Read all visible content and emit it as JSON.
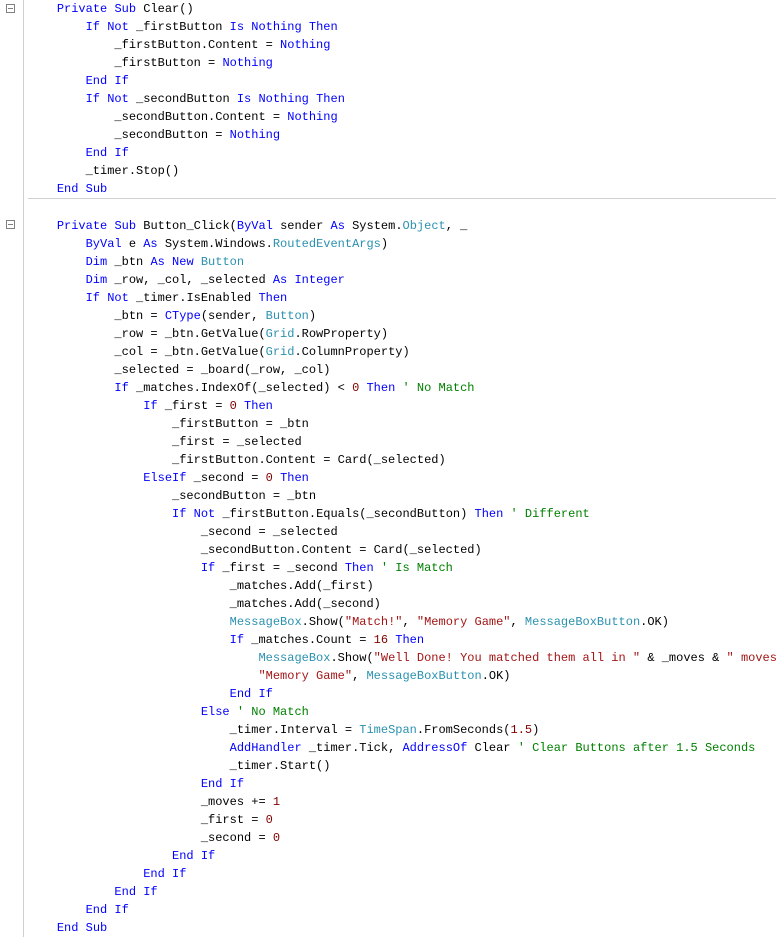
{
  "colors": {
    "keyword": "#0000ff",
    "type": "#2b91af",
    "number": "#800000",
    "string": "#a31515",
    "comment": "#008000",
    "text": "#000000"
  },
  "font": "Consolas",
  "blocks": [
    {
      "id": "clear",
      "collapse_marker_row": 0,
      "lines": [
        [
          [
            "pl",
            "    "
          ],
          [
            "kw",
            "Private"
          ],
          [
            "pl",
            " "
          ],
          [
            "kw",
            "Sub"
          ],
          [
            "pl",
            " Clear()"
          ]
        ],
        [
          [
            "pl",
            "        "
          ],
          [
            "kw",
            "If"
          ],
          [
            "pl",
            " "
          ],
          [
            "kw",
            "Not"
          ],
          [
            "pl",
            " _firstButton "
          ],
          [
            "kw",
            "Is"
          ],
          [
            "pl",
            " "
          ],
          [
            "kw",
            "Nothing"
          ],
          [
            "pl",
            " "
          ],
          [
            "kw",
            "Then"
          ]
        ],
        [
          [
            "pl",
            "            _firstButton.Content = "
          ],
          [
            "kw",
            "Nothing"
          ]
        ],
        [
          [
            "pl",
            "            _firstButton = "
          ],
          [
            "kw",
            "Nothing"
          ]
        ],
        [
          [
            "pl",
            "        "
          ],
          [
            "kw",
            "End"
          ],
          [
            "pl",
            " "
          ],
          [
            "kw",
            "If"
          ]
        ],
        [
          [
            "pl",
            "        "
          ],
          [
            "kw",
            "If"
          ],
          [
            "pl",
            " "
          ],
          [
            "kw",
            "Not"
          ],
          [
            "pl",
            " _secondButton "
          ],
          [
            "kw",
            "Is"
          ],
          [
            "pl",
            " "
          ],
          [
            "kw",
            "Nothing"
          ],
          [
            "pl",
            " "
          ],
          [
            "kw",
            "Then"
          ]
        ],
        [
          [
            "pl",
            "            _secondButton.Content = "
          ],
          [
            "kw",
            "Nothing"
          ]
        ],
        [
          [
            "pl",
            "            _secondButton = "
          ],
          [
            "kw",
            "Nothing"
          ]
        ],
        [
          [
            "pl",
            "        "
          ],
          [
            "kw",
            "End"
          ],
          [
            "pl",
            " "
          ],
          [
            "kw",
            "If"
          ]
        ],
        [
          [
            "pl",
            "        _timer.Stop()"
          ]
        ],
        [
          [
            "pl",
            "    "
          ],
          [
            "kw",
            "End"
          ],
          [
            "pl",
            " "
          ],
          [
            "kw",
            "Sub"
          ]
        ]
      ]
    },
    {
      "id": "button_click",
      "collapse_marker_row": 0,
      "lines": [
        [
          [
            "pl",
            "    "
          ],
          [
            "kw",
            "Private"
          ],
          [
            "pl",
            " "
          ],
          [
            "kw",
            "Sub"
          ],
          [
            "pl",
            " Button_Click("
          ],
          [
            "kw",
            "ByVal"
          ],
          [
            "pl",
            " sender "
          ],
          [
            "kw",
            "As"
          ],
          [
            "pl",
            " System."
          ],
          [
            "typ",
            "Object"
          ],
          [
            "pl",
            ", _"
          ]
        ],
        [
          [
            "pl",
            "        "
          ],
          [
            "kw",
            "ByVal"
          ],
          [
            "pl",
            " e "
          ],
          [
            "kw",
            "As"
          ],
          [
            "pl",
            " System.Windows."
          ],
          [
            "typ",
            "RoutedEventArgs"
          ],
          [
            "pl",
            ")"
          ]
        ],
        [
          [
            "pl",
            "        "
          ],
          [
            "kw",
            "Dim"
          ],
          [
            "pl",
            " _btn "
          ],
          [
            "kw",
            "As"
          ],
          [
            "pl",
            " "
          ],
          [
            "kw",
            "New"
          ],
          [
            "pl",
            " "
          ],
          [
            "typ",
            "Button"
          ]
        ],
        [
          [
            "pl",
            "        "
          ],
          [
            "kw",
            "Dim"
          ],
          [
            "pl",
            " _row, _col, _selected "
          ],
          [
            "kw",
            "As"
          ],
          [
            "pl",
            " "
          ],
          [
            "kw",
            "Integer"
          ]
        ],
        [
          [
            "pl",
            "        "
          ],
          [
            "kw",
            "If"
          ],
          [
            "pl",
            " "
          ],
          [
            "kw",
            "Not"
          ],
          [
            "pl",
            " _timer.IsEnabled "
          ],
          [
            "kw",
            "Then"
          ]
        ],
        [
          [
            "pl",
            "            _btn = "
          ],
          [
            "kw",
            "CType"
          ],
          [
            "pl",
            "(sender, "
          ],
          [
            "typ",
            "Button"
          ],
          [
            "pl",
            ")"
          ]
        ],
        [
          [
            "pl",
            "            _row = _btn.GetValue("
          ],
          [
            "typ",
            "Grid"
          ],
          [
            "pl",
            ".RowProperty)"
          ]
        ],
        [
          [
            "pl",
            "            _col = _btn.GetValue("
          ],
          [
            "typ",
            "Grid"
          ],
          [
            "pl",
            ".ColumnProperty)"
          ]
        ],
        [
          [
            "pl",
            "            _selected = _board(_row, _col)"
          ]
        ],
        [
          [
            "pl",
            "            "
          ],
          [
            "kw",
            "If"
          ],
          [
            "pl",
            " _matches.IndexOf(_selected) < "
          ],
          [
            "num",
            "0"
          ],
          [
            "pl",
            " "
          ],
          [
            "kw",
            "Then"
          ],
          [
            "pl",
            " "
          ],
          [
            "cmt",
            "' No Match"
          ]
        ],
        [
          [
            "pl",
            "                "
          ],
          [
            "kw",
            "If"
          ],
          [
            "pl",
            " _first = "
          ],
          [
            "num",
            "0"
          ],
          [
            "pl",
            " "
          ],
          [
            "kw",
            "Then"
          ]
        ],
        [
          [
            "pl",
            "                    _firstButton = _btn"
          ]
        ],
        [
          [
            "pl",
            "                    _first = _selected"
          ]
        ],
        [
          [
            "pl",
            "                    _firstButton.Content = Card(_selected)"
          ]
        ],
        [
          [
            "pl",
            "                "
          ],
          [
            "kw",
            "ElseIf"
          ],
          [
            "pl",
            " _second = "
          ],
          [
            "num",
            "0"
          ],
          [
            "pl",
            " "
          ],
          [
            "kw",
            "Then"
          ]
        ],
        [
          [
            "pl",
            "                    _secondButton = _btn"
          ]
        ],
        [
          [
            "pl",
            "                    "
          ],
          [
            "kw",
            "If"
          ],
          [
            "pl",
            " "
          ],
          [
            "kw",
            "Not"
          ],
          [
            "pl",
            " _firstButton.Equals(_secondButton) "
          ],
          [
            "kw",
            "Then"
          ],
          [
            "pl",
            " "
          ],
          [
            "cmt",
            "' Different"
          ]
        ],
        [
          [
            "pl",
            "                        _second = _selected"
          ]
        ],
        [
          [
            "pl",
            "                        _secondButton.Content = Card(_selected)"
          ]
        ],
        [
          [
            "pl",
            "                        "
          ],
          [
            "kw",
            "If"
          ],
          [
            "pl",
            " _first = _second "
          ],
          [
            "kw",
            "Then"
          ],
          [
            "pl",
            " "
          ],
          [
            "cmt",
            "' Is Match"
          ]
        ],
        [
          [
            "pl",
            "                            _matches.Add(_first)"
          ]
        ],
        [
          [
            "pl",
            "                            _matches.Add(_second)"
          ]
        ],
        [
          [
            "pl",
            "                            "
          ],
          [
            "typ",
            "MessageBox"
          ],
          [
            "pl",
            ".Show("
          ],
          [
            "str",
            "\"Match!\""
          ],
          [
            "pl",
            ", "
          ],
          [
            "str",
            "\"Memory Game\""
          ],
          [
            "pl",
            ", "
          ],
          [
            "typ",
            "MessageBoxButton"
          ],
          [
            "pl",
            ".OK)"
          ]
        ],
        [
          [
            "pl",
            "                            "
          ],
          [
            "kw",
            "If"
          ],
          [
            "pl",
            " _matches.Count = "
          ],
          [
            "num",
            "16"
          ],
          [
            "pl",
            " "
          ],
          [
            "kw",
            "Then"
          ]
        ],
        [
          [
            "pl",
            "                                "
          ],
          [
            "typ",
            "MessageBox"
          ],
          [
            "pl",
            ".Show("
          ],
          [
            "str",
            "\"Well Done! You matched them all in \""
          ],
          [
            "pl",
            " & _moves & "
          ],
          [
            "str",
            "\" moves!\""
          ],
          [
            "pl",
            ", _"
          ]
        ],
        [
          [
            "pl",
            "                                "
          ],
          [
            "str",
            "\"Memory Game\""
          ],
          [
            "pl",
            ", "
          ],
          [
            "typ",
            "MessageBoxButton"
          ],
          [
            "pl",
            ".OK)"
          ]
        ],
        [
          [
            "pl",
            "                            "
          ],
          [
            "kw",
            "End"
          ],
          [
            "pl",
            " "
          ],
          [
            "kw",
            "If"
          ]
        ],
        [
          [
            "pl",
            "                        "
          ],
          [
            "kw",
            "Else"
          ],
          [
            "pl",
            " "
          ],
          [
            "cmt",
            "' No Match"
          ]
        ],
        [
          [
            "pl",
            "                            _timer.Interval = "
          ],
          [
            "typ",
            "TimeSpan"
          ],
          [
            "pl",
            ".FromSeconds("
          ],
          [
            "num",
            "1.5"
          ],
          [
            "pl",
            ")"
          ]
        ],
        [
          [
            "pl",
            "                            "
          ],
          [
            "kw",
            "AddHandler"
          ],
          [
            "pl",
            " _timer.Tick, "
          ],
          [
            "kw",
            "AddressOf"
          ],
          [
            "pl",
            " Clear "
          ],
          [
            "cmt",
            "' Clear Buttons after 1.5 Seconds"
          ]
        ],
        [
          [
            "pl",
            "                            _timer.Start()"
          ]
        ],
        [
          [
            "pl",
            "                        "
          ],
          [
            "kw",
            "End"
          ],
          [
            "pl",
            " "
          ],
          [
            "kw",
            "If"
          ]
        ],
        [
          [
            "pl",
            "                        _moves += "
          ],
          [
            "num",
            "1"
          ]
        ],
        [
          [
            "pl",
            "                        _first = "
          ],
          [
            "num",
            "0"
          ]
        ],
        [
          [
            "pl",
            "                        _second = "
          ],
          [
            "num",
            "0"
          ]
        ],
        [
          [
            "pl",
            "                    "
          ],
          [
            "kw",
            "End"
          ],
          [
            "pl",
            " "
          ],
          [
            "kw",
            "If"
          ]
        ],
        [
          [
            "pl",
            "                "
          ],
          [
            "kw",
            "End"
          ],
          [
            "pl",
            " "
          ],
          [
            "kw",
            "If"
          ]
        ],
        [
          [
            "pl",
            "            "
          ],
          [
            "kw",
            "End"
          ],
          [
            "pl",
            " "
          ],
          [
            "kw",
            "If"
          ]
        ],
        [
          [
            "pl",
            "        "
          ],
          [
            "kw",
            "End"
          ],
          [
            "pl",
            " "
          ],
          [
            "kw",
            "If"
          ]
        ],
        [
          [
            "pl",
            "    "
          ],
          [
            "kw",
            "End"
          ],
          [
            "pl",
            " "
          ],
          [
            "kw",
            "Sub"
          ]
        ]
      ]
    }
  ]
}
